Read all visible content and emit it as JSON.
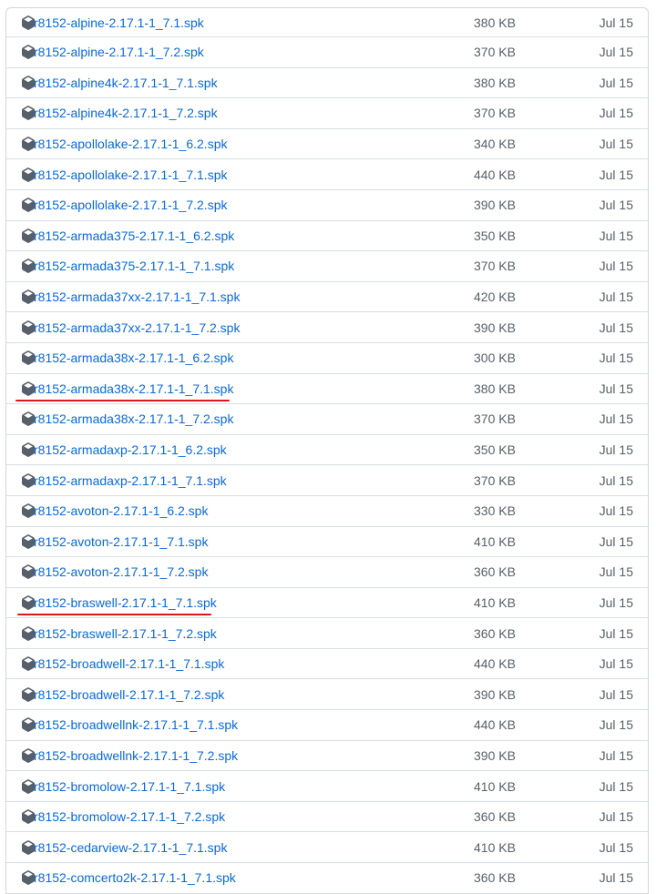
{
  "assets": [
    {
      "name": "r8152-alpine-2.17.1-1_7.1.spk",
      "size": "380 KB",
      "date": "Jul 15"
    },
    {
      "name": "r8152-alpine-2.17.1-1_7.2.spk",
      "size": "370 KB",
      "date": "Jul 15"
    },
    {
      "name": "r8152-alpine4k-2.17.1-1_7.1.spk",
      "size": "380 KB",
      "date": "Jul 15"
    },
    {
      "name": "r8152-alpine4k-2.17.1-1_7.2.spk",
      "size": "370 KB",
      "date": "Jul 15"
    },
    {
      "name": "r8152-apollolake-2.17.1-1_6.2.spk",
      "size": "340 KB",
      "date": "Jul 15"
    },
    {
      "name": "r8152-apollolake-2.17.1-1_7.1.spk",
      "size": "440 KB",
      "date": "Jul 15"
    },
    {
      "name": "r8152-apollolake-2.17.1-1_7.2.spk",
      "size": "390 KB",
      "date": "Jul 15"
    },
    {
      "name": "r8152-armada375-2.17.1-1_6.2.spk",
      "size": "350 KB",
      "date": "Jul 15"
    },
    {
      "name": "r8152-armada375-2.17.1-1_7.1.spk",
      "size": "370 KB",
      "date": "Jul 15"
    },
    {
      "name": "r8152-armada37xx-2.17.1-1_7.1.spk",
      "size": "420 KB",
      "date": "Jul 15"
    },
    {
      "name": "r8152-armada37xx-2.17.1-1_7.2.spk",
      "size": "390 KB",
      "date": "Jul 15"
    },
    {
      "name": "r8152-armada38x-2.17.1-1_6.2.spk",
      "size": "300 KB",
      "date": "Jul 15"
    },
    {
      "name": "r8152-armada38x-2.17.1-1_7.1.spk",
      "size": "380 KB",
      "date": "Jul 15"
    },
    {
      "name": "r8152-armada38x-2.17.1-1_7.2.spk",
      "size": "370 KB",
      "date": "Jul 15"
    },
    {
      "name": "r8152-armadaxp-2.17.1-1_6.2.spk",
      "size": "350 KB",
      "date": "Jul 15"
    },
    {
      "name": "r8152-armadaxp-2.17.1-1_7.1.spk",
      "size": "370 KB",
      "date": "Jul 15"
    },
    {
      "name": "r8152-avoton-2.17.1-1_6.2.spk",
      "size": "330 KB",
      "date": "Jul 15"
    },
    {
      "name": "r8152-avoton-2.17.1-1_7.1.spk",
      "size": "410 KB",
      "date": "Jul 15"
    },
    {
      "name": "r8152-avoton-2.17.1-1_7.2.spk",
      "size": "360 KB",
      "date": "Jul 15"
    },
    {
      "name": "r8152-braswell-2.17.1-1_7.1.spk",
      "size": "410 KB",
      "date": "Jul 15"
    },
    {
      "name": "r8152-braswell-2.17.1-1_7.2.spk",
      "size": "360 KB",
      "date": "Jul 15"
    },
    {
      "name": "r8152-broadwell-2.17.1-1_7.1.spk",
      "size": "440 KB",
      "date": "Jul 15"
    },
    {
      "name": "r8152-broadwell-2.17.1-1_7.2.spk",
      "size": "390 KB",
      "date": "Jul 15"
    },
    {
      "name": "r8152-broadwellnk-2.17.1-1_7.1.spk",
      "size": "440 KB",
      "date": "Jul 15"
    },
    {
      "name": "r8152-broadwellnk-2.17.1-1_7.2.spk",
      "size": "390 KB",
      "date": "Jul 15"
    },
    {
      "name": "r8152-bromolow-2.17.1-1_7.1.spk",
      "size": "410 KB",
      "date": "Jul 15"
    },
    {
      "name": "r8152-bromolow-2.17.1-1_7.2.spk",
      "size": "360 KB",
      "date": "Jul 15"
    },
    {
      "name": "r8152-cedarview-2.17.1-1_7.1.spk",
      "size": "410 KB",
      "date": "Jul 15"
    },
    {
      "name": "r8152-comcerto2k-2.17.1-1_7.1.spk",
      "size": "360 KB",
      "date": "Jul 15"
    }
  ],
  "icon": "package-icon",
  "colors": {
    "link": "#0969da",
    "muted_text": "#57606a",
    "border": "#d0d7de",
    "annotation_underline": "#e0141b"
  }
}
